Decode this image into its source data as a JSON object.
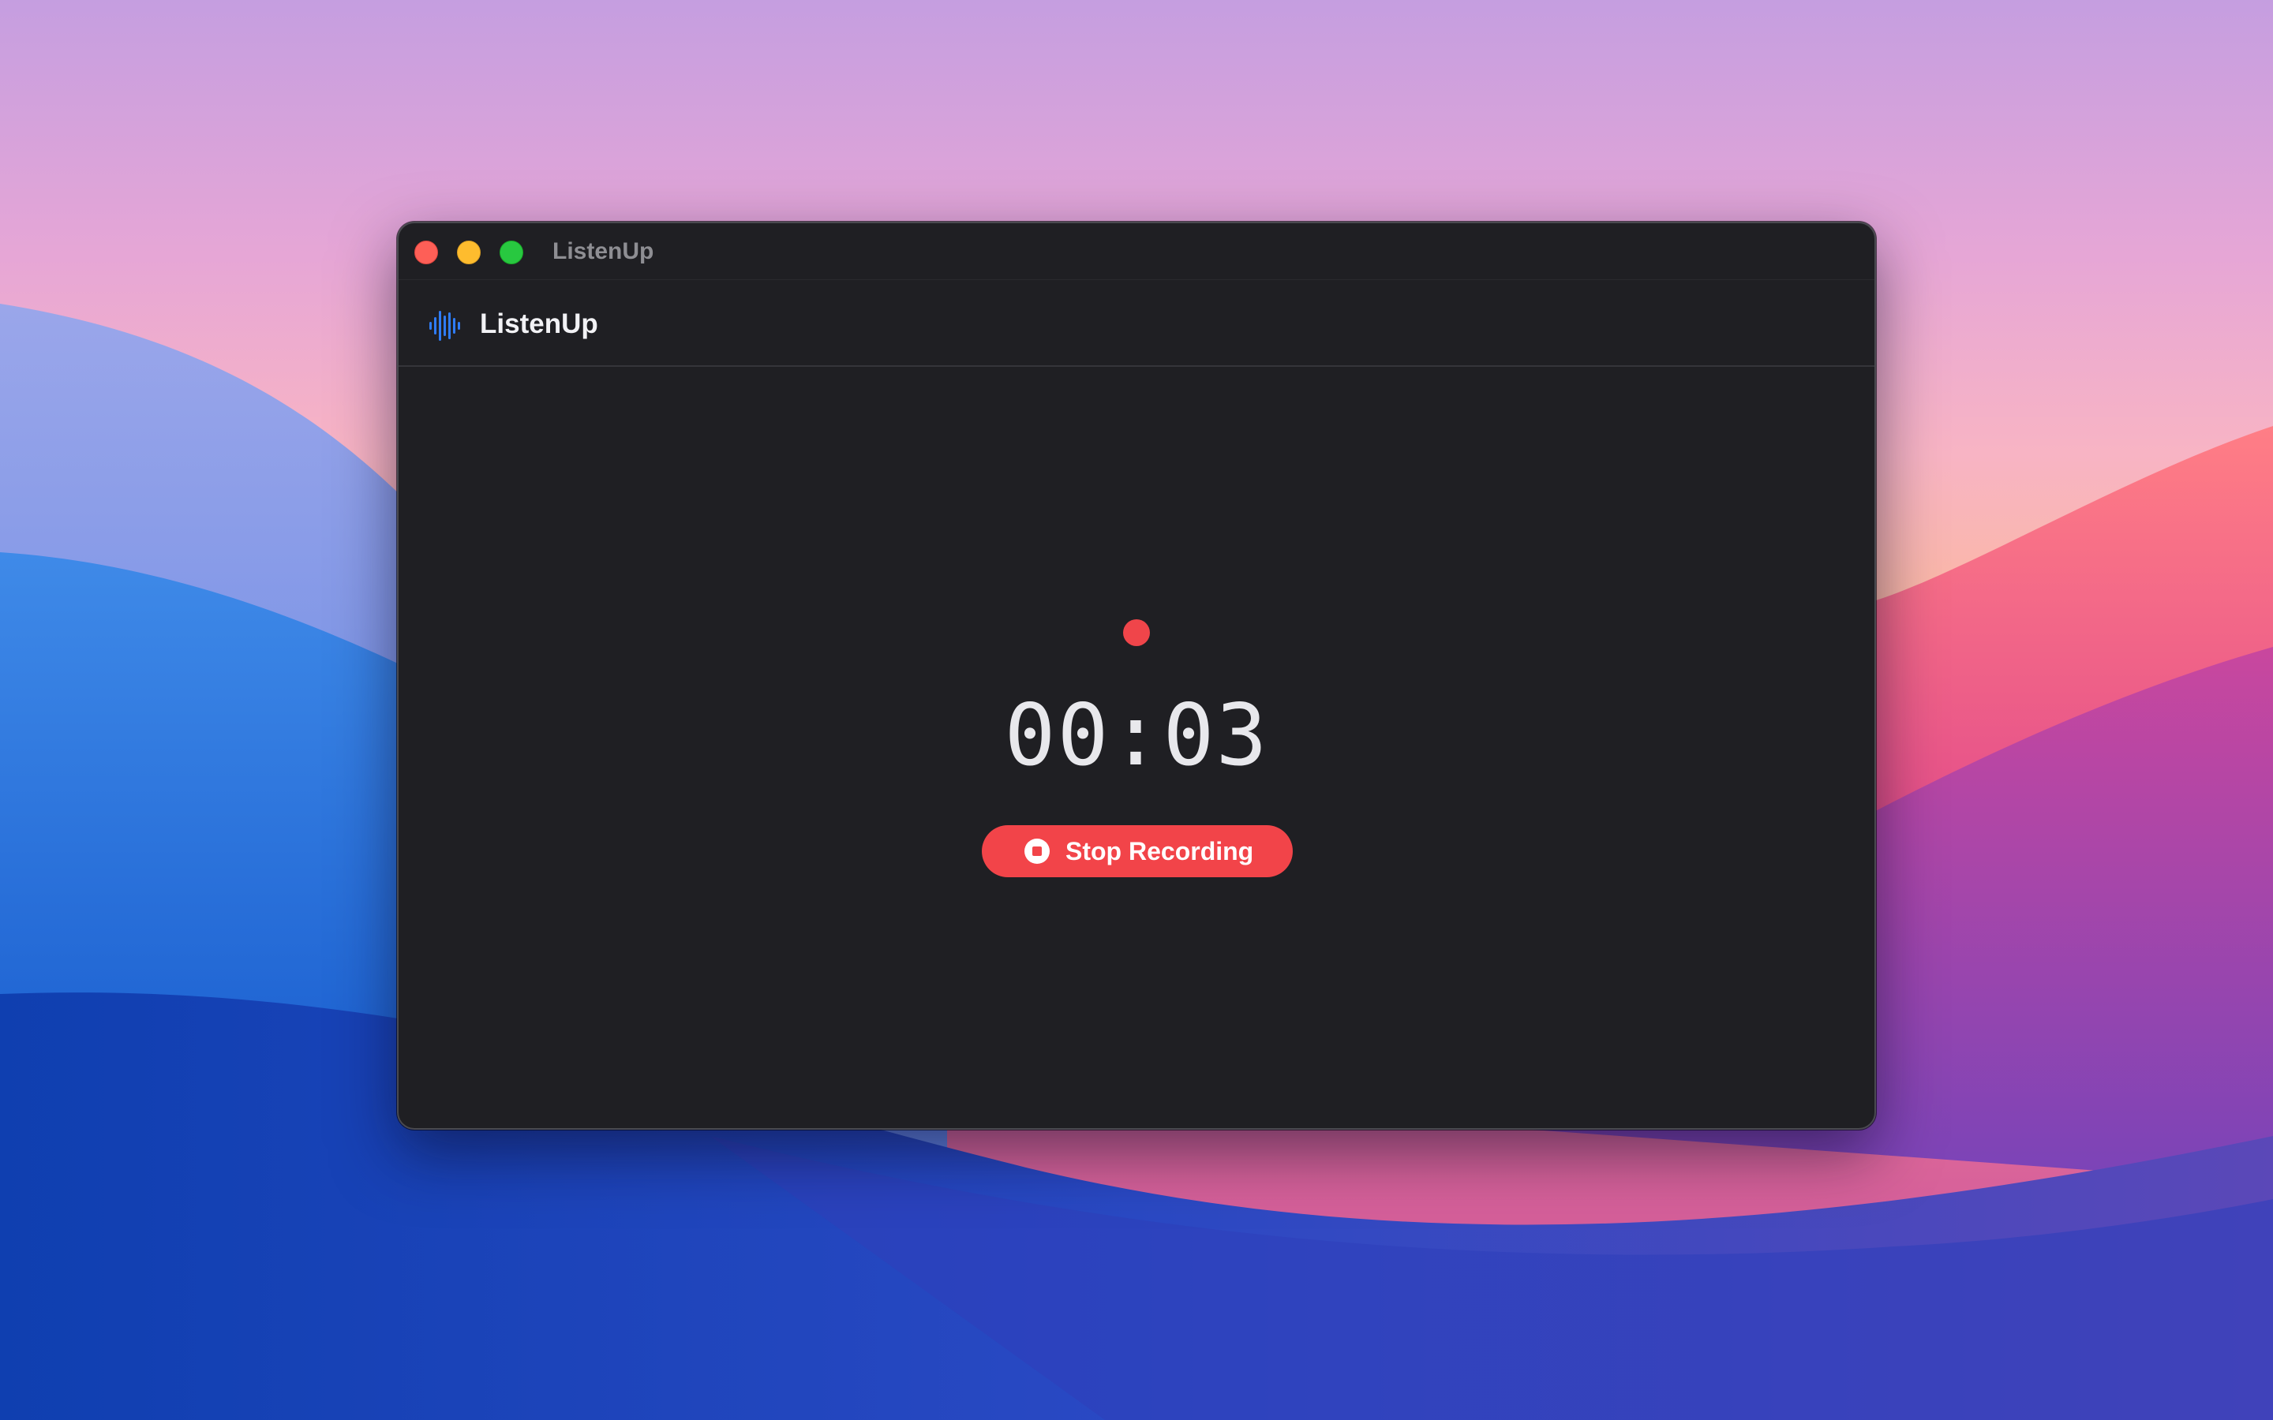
{
  "window": {
    "title": "ListenUp"
  },
  "app_header": {
    "logo_icon": "waveform-icon",
    "name": "ListenUp"
  },
  "recording": {
    "indicator_icon": "recording-dot-icon",
    "elapsed": "00:03",
    "stop_icon": "stop-circle-icon",
    "stop_label": "Stop Recording"
  },
  "colors": {
    "window_bg": "#1f1f23",
    "accent_red": "#f24449",
    "logo_blue": "#2f7cf6",
    "traffic_close": "#fe5f57",
    "traffic_minimize": "#febc2e",
    "traffic_zoom": "#28c840"
  }
}
